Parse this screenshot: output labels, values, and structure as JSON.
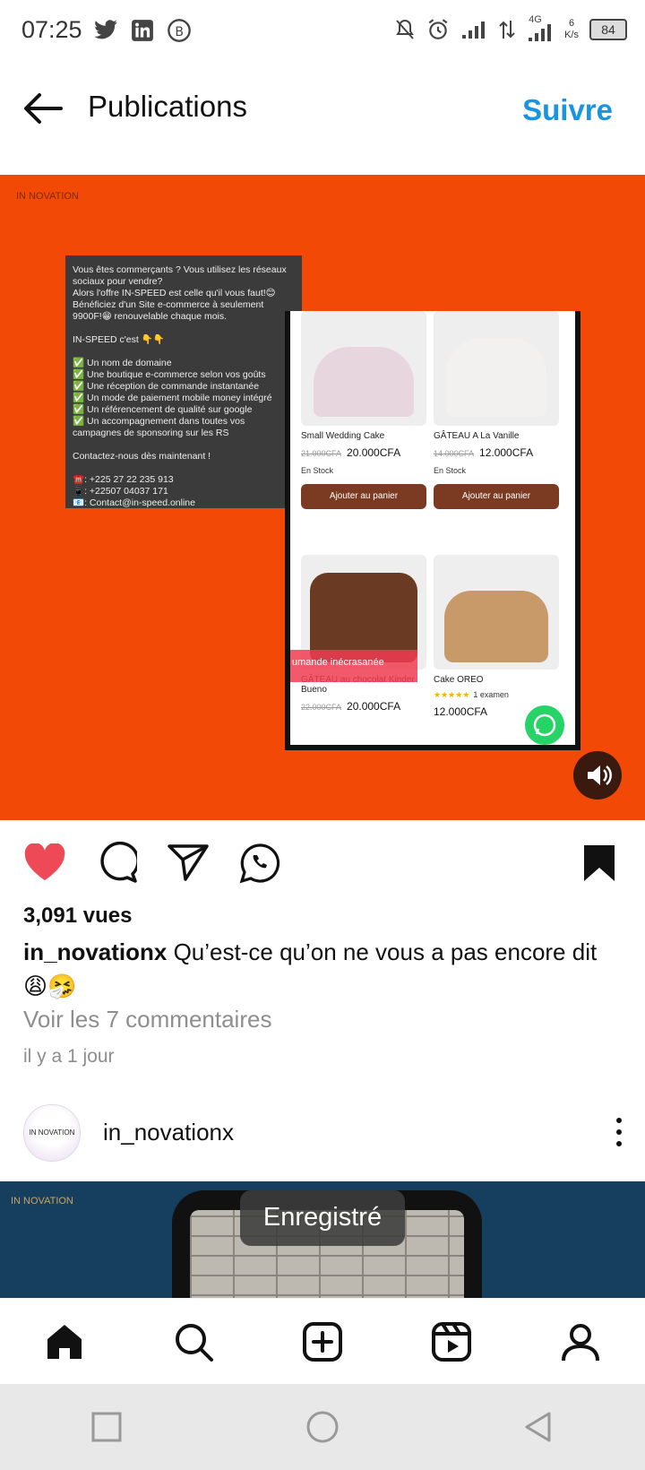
{
  "status_bar": {
    "time": "07:25",
    "left_icons": [
      "twitter-icon",
      "linkedin-icon",
      "b-circle-icon"
    ],
    "right_icons": [
      "mute-icon",
      "alarm-icon",
      "signal-icon",
      "data-arrows-icon",
      "signal-4g-icon"
    ],
    "network_label": "4G",
    "net_speed_value": "6",
    "net_speed_unit": "K/s",
    "battery": "84"
  },
  "header": {
    "title": "Publications",
    "follow": "Suivre"
  },
  "post1": {
    "brand": "IN NOVATION",
    "promo_text": "Vous êtes commerçants ? Vous utilisez les réseaux sociaux pour vendre?\nAlors l'offre IN-SPEED est celle qu'il vous faut!😊\nBénéficiez d'un Site e-commerce à seulement 9900F!😁 renouvelable chaque mois.\n\nIN-SPEED c'est 👇👇\n\n✅ Un nom de domaine\n✅ Une boutique e-commerce selon vos goûts\n✅ Une réception de commande instantanée\n✅ Un mode de paiement mobile money intégré\n✅ Un référencement de qualité sur google\n✅ Un accompagnement dans toutes vos campagnes de sponsoring sur les RS\n\nContactez-nous dès maintenant !\n\n☎️: +225 27 22 235 913\n📱: +22507 04037 171\n📧: Contact@in-speed.online",
    "products": [
      {
        "name": "Small Wedding Cake",
        "old_price": "21.000CFA",
        "price": "20.000CFA",
        "stock": "En Stock",
        "button": "Ajouter au panier"
      },
      {
        "name": "GÂTEAU A La Vanille",
        "old_price": "14.000CFA",
        "price": "12.000CFA",
        "stock": "En Stock",
        "button": "Ajouter au panier"
      },
      {
        "name": "GÂTEAU au chocolat Kinder Bueno",
        "old_price": "22.000CFA",
        "price": "20.000CFA"
      },
      {
        "name": "Cake OREO",
        "rating_text": "1 examen",
        "price": "12.000CFA"
      }
    ],
    "sale_strip": "umande inécrasanée",
    "views": "3,091 vues",
    "caption_user": "in_novationx",
    "caption_text": " Qu’est-ce qu’on ne vous a pas encore dit 😩🤧",
    "comments_link": "Voir les 7 commentaires",
    "timestamp": "il y a 1 jour",
    "liked": true,
    "saved": true
  },
  "post2": {
    "username": "in_novationx",
    "avatar_text": "IN NOVATION",
    "brand": "IN NOVATION"
  },
  "toast": "Enregistré",
  "colors": {
    "accent": "#1a94e0",
    "like": "#ed4956",
    "media_bg": "#f24a06"
  },
  "bottom_nav": [
    "home-icon",
    "search-icon",
    "create-icon",
    "reels-icon",
    "profile-icon"
  ],
  "system_nav": [
    "recents-icon",
    "home-circle-icon",
    "back-triangle-icon"
  ]
}
